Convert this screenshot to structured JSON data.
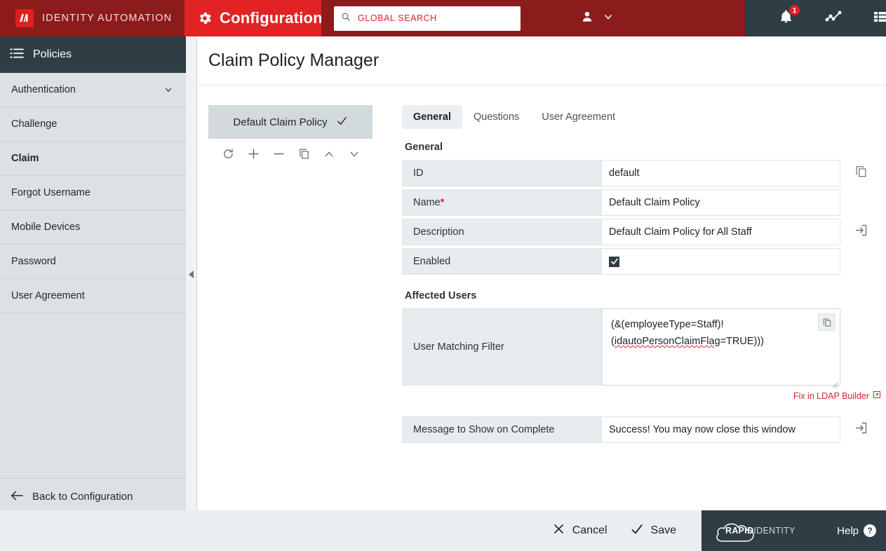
{
  "topbar": {
    "brand_name": "IDENTITY AUTOMATION",
    "brand_logo_icon": "identity-automation-logo",
    "config_label": "Configuration",
    "config_icon": "gear-icon",
    "config_caret_icon": "chevron-down-icon",
    "search": {
      "placeholder": "GLOBAL SEARCH",
      "value": "",
      "icon": "search-icon"
    },
    "user_icon": "person-icon",
    "user_caret_icon": "chevron-down-icon",
    "notifications": {
      "icon": "bell-icon",
      "badge_count": "1"
    },
    "activity_icon": "line-chart-icon",
    "list_icon": "list-grid-icon",
    "colors": {
      "brand_dark_red": "#8c1b1b",
      "accent_red": "#e02424",
      "slate": "#2f3d45",
      "badge_red": "#e01f2a"
    }
  },
  "sidebar": {
    "header_label": "Policies",
    "header_icon": "list-icon",
    "items": [
      {
        "label": "Authentication",
        "caret_icon": "chevron-down-icon",
        "active": false
      },
      {
        "label": "Challenge",
        "active": false
      },
      {
        "label": "Claim",
        "active": true
      },
      {
        "label": "Forgot Username",
        "active": false
      },
      {
        "label": "Mobile Devices",
        "active": false
      },
      {
        "label": "Password",
        "active": false
      },
      {
        "label": "User Agreement",
        "active": false
      }
    ],
    "back_label": "Back to Configuration",
    "back_icon": "arrow-left-icon",
    "collapse_icon": "collapse-left-triangle-icon"
  },
  "main": {
    "page_title": "Claim Policy Manager",
    "policy_list": {
      "selected_item": "Default Claim Policy",
      "selected_check_icon": "check-icon",
      "tools": [
        {
          "name": "refresh",
          "icon": "refresh-icon"
        },
        {
          "name": "add",
          "icon": "plus-icon"
        },
        {
          "name": "remove",
          "icon": "minus-icon"
        },
        {
          "name": "duplicate",
          "icon": "copy-icon"
        },
        {
          "name": "move-up",
          "icon": "chevron-up-icon"
        },
        {
          "name": "move-down",
          "icon": "chevron-down-icon"
        }
      ]
    },
    "tabs": [
      {
        "label": "General",
        "active": true
      },
      {
        "label": "Questions",
        "active": false
      },
      {
        "label": "User Agreement",
        "active": false
      }
    ],
    "general_section": {
      "heading": "General",
      "fields": [
        {
          "label": "ID",
          "value": "default",
          "action_icon": "copy-icon",
          "type": "text"
        },
        {
          "label": "Name",
          "required": "*",
          "value": "Default Claim Policy",
          "type": "text"
        },
        {
          "label": "Description",
          "value": "Default Claim Policy for All Staff",
          "action_icon": "import-icon",
          "type": "text"
        },
        {
          "label": "Enabled",
          "value": "",
          "checked": true,
          "type": "checkbox",
          "check_icon": "check-icon"
        }
      ]
    },
    "affected_users_section": {
      "heading": "Affected Users",
      "filter_label": "User Matching Filter",
      "filter_value_line1": "(&(employeeType=Staff)!",
      "filter_value_line2_prefix": "(",
      "filter_value_misspelled": "idautoPersonClaimFlag",
      "filter_value_line2_suffix": "=TRUE)))",
      "filter_copy_icon": "copy-icon",
      "resize_icon": "resize-grip-icon",
      "ldap_link_label": "Fix in LDAP Builder",
      "ldap_link_icon": "external-link-icon"
    },
    "complete_message_field": {
      "label": "Message to Show on Complete",
      "value": "Success!  You may now close this window",
      "action_icon": "import-icon"
    }
  },
  "footer": {
    "cancel_label": "Cancel",
    "cancel_icon": "close-x-icon",
    "save_label": "Save",
    "save_icon": "check-icon",
    "logo_rapid": "RAPID",
    "logo_identity": "IDENTITY",
    "logo_icon": "rapididentity-cloud-logo",
    "help_label": "Help",
    "help_icon": "question-mark-icon"
  }
}
